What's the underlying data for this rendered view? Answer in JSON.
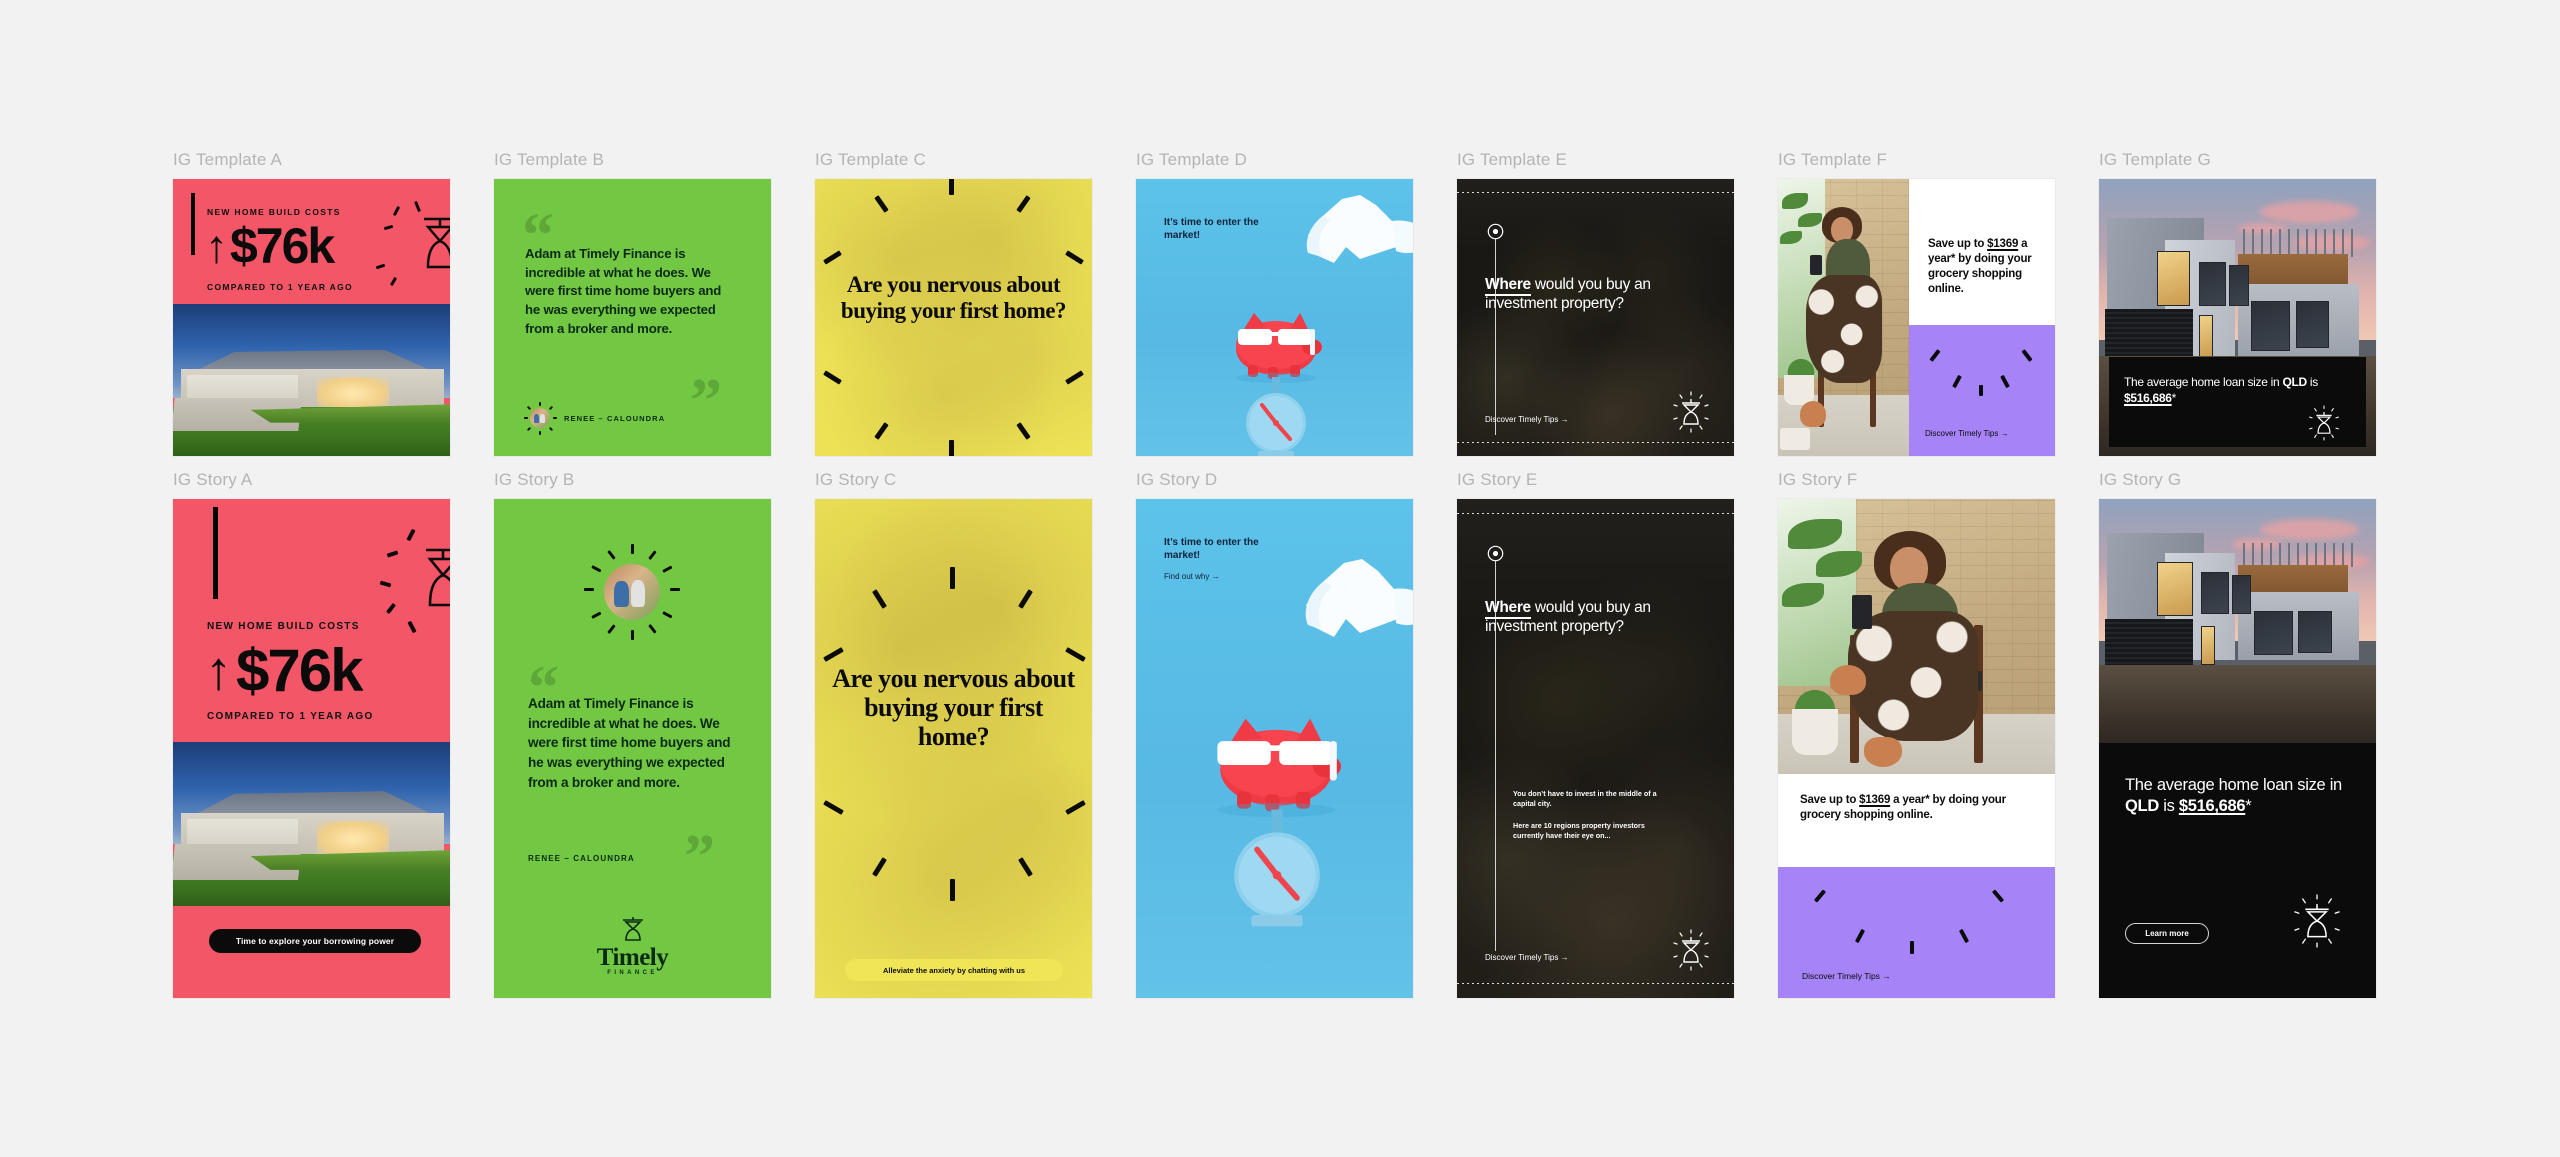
{
  "board": {
    "background_color": "#f2f2f2",
    "label_color": "#b4b4b4"
  },
  "brand": {
    "name": "Timely",
    "sub": "FINANCE",
    "colors": {
      "red": "#f25667",
      "green": "#73c843",
      "yellow": "#efe557",
      "blue": "#5cc3ea",
      "purple": "#a683f7",
      "black": "#0b0b0b",
      "white": "#ffffff"
    }
  },
  "cards": [
    {
      "id": "ig-template-a",
      "label": "IG Template A",
      "format": "square",
      "eyebrow": "NEW HOME BUILD COSTS",
      "arrow": "↑",
      "stat": "$76k",
      "subline": "COMPARED TO 1 YEAR AGO"
    },
    {
      "id": "ig-template-b",
      "label": "IG Template B",
      "format": "square",
      "quote": "Adam at Timely Finance is incredible at what he does. We were first time home buyers and he was everything we expected from a broker and more.",
      "attribution": "RENEE – CALOUNDRA",
      "open_quote": "“",
      "close_quote": "”"
    },
    {
      "id": "ig-template-c",
      "label": "IG Template C",
      "format": "square",
      "headline": "Are you nervous about buying your first home?"
    },
    {
      "id": "ig-template-d",
      "label": "IG Template D",
      "format": "square",
      "headline": "It’s time to enter the market!"
    },
    {
      "id": "ig-template-e",
      "label": "IG Template E",
      "format": "square",
      "headline_strong": "Where",
      "headline_rest": " would you buy an investment property?",
      "link": "Discover Timely Tips →"
    },
    {
      "id": "ig-template-f",
      "label": "IG Template F",
      "format": "square",
      "copy_pre": "Save up to ",
      "copy_amount": "$1369",
      "copy_post": " a year* by doing your grocery shopping online.",
      "link": "Discover Timely Tips →"
    },
    {
      "id": "ig-template-g",
      "label": "IG Template G",
      "format": "square",
      "copy_pre": "The average home loan size in ",
      "copy_state": "QLD",
      "copy_mid": " is ",
      "copy_amount": "$516,686",
      "copy_post": "*"
    },
    {
      "id": "ig-story-a",
      "label": "IG Story A",
      "format": "story",
      "eyebrow": "NEW HOME BUILD COSTS",
      "arrow": "↑",
      "stat": "$76k",
      "subline": "COMPARED TO 1 YEAR AGO",
      "cta": "Time to explore your borrowing power"
    },
    {
      "id": "ig-story-b",
      "label": "IG Story B",
      "format": "story",
      "quote": "Adam at Timely Finance is incredible at what he does. We were first time home buyers and he was everything we expected from a broker and more.",
      "attribution": "RENEE – CALOUNDRA",
      "open_quote": "“",
      "close_quote": "”",
      "logo_name": "Timely",
      "logo_sub": "FINANCE"
    },
    {
      "id": "ig-story-c",
      "label": "IG Story C",
      "format": "story",
      "headline": "Are you nervous about buying your first home?",
      "cta": "Alleviate the anxiety by chatting with us"
    },
    {
      "id": "ig-story-d",
      "label": "IG Story D",
      "format": "story",
      "headline": "It’s time to enter the market!",
      "sub": "Find out why →"
    },
    {
      "id": "ig-story-e",
      "label": "IG Story E",
      "format": "story",
      "headline_strong": "Where",
      "headline_rest": " would you buy an investment property?",
      "body_1": "You don’t have to invest in the middle of a capital city.",
      "body_2": "Here are 10 regions property investors currently have their eye on...",
      "link": "Discover Timely Tips →"
    },
    {
      "id": "ig-story-f",
      "label": "IG Story F",
      "format": "story",
      "copy_pre": "Save up to ",
      "copy_amount": "$1369",
      "copy_post": " a year* by doing your grocery shopping online.",
      "link": "Discover Timely Tips →"
    },
    {
      "id": "ig-story-g",
      "label": "IG Story G",
      "format": "story",
      "copy_pre": "The average home loan size in ",
      "copy_state": "QLD",
      "copy_mid": " is ",
      "copy_amount": "$516,686",
      "copy_post": "*",
      "cta": "Learn more"
    }
  ]
}
